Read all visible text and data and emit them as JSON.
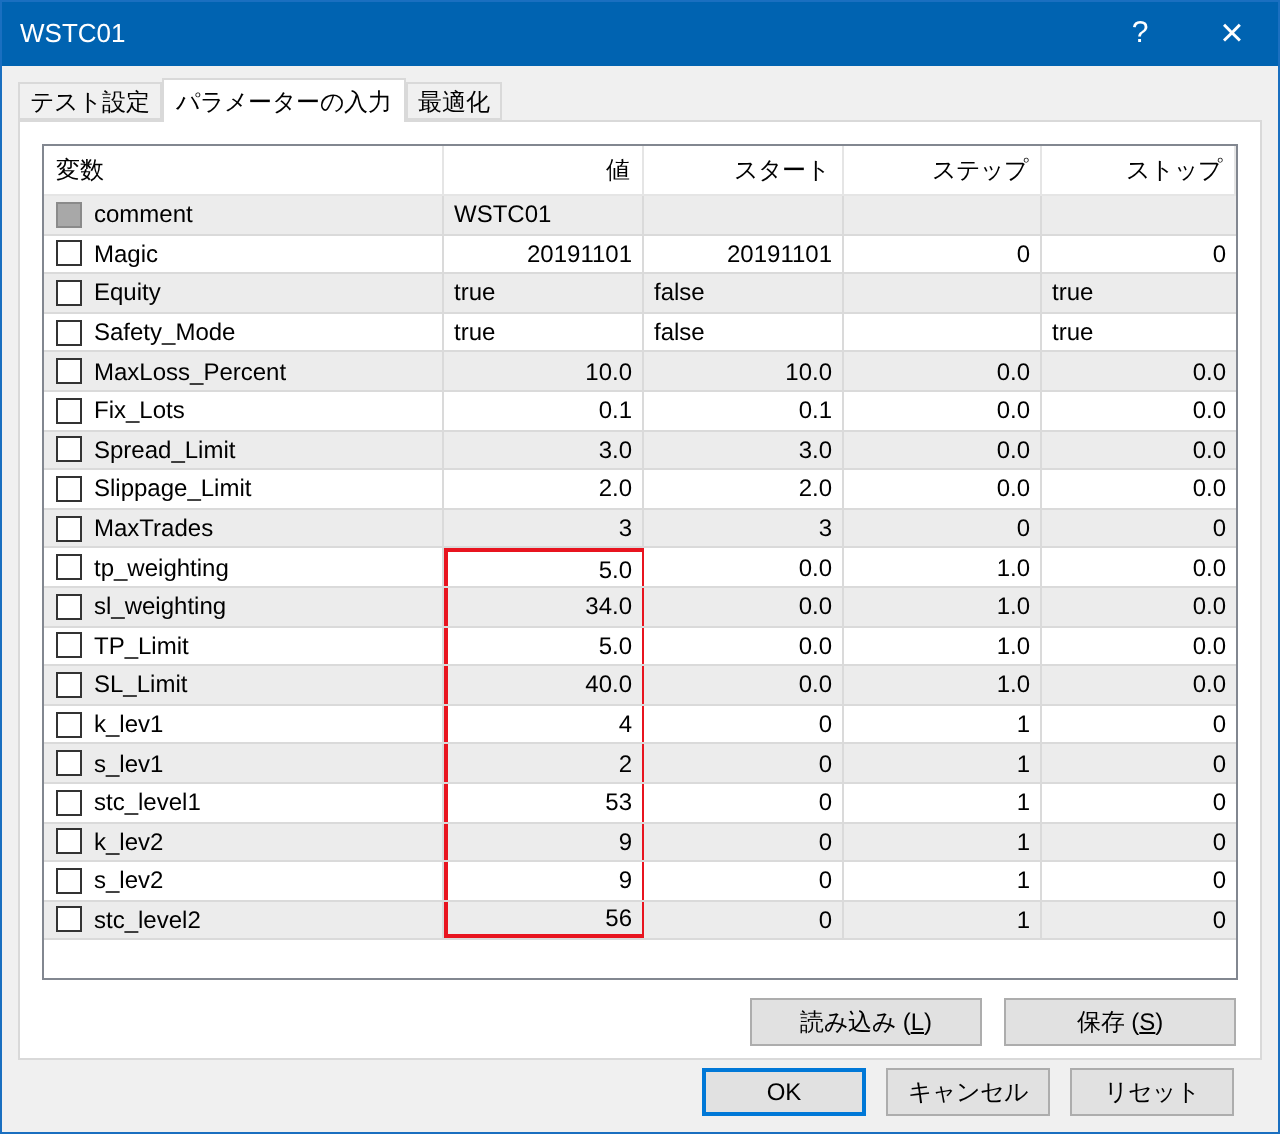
{
  "window": {
    "title": "WSTC01",
    "help": "?",
    "close": "×"
  },
  "tabs": [
    {
      "label": "テスト設定",
      "selected": false
    },
    {
      "label": "パラメーターの入力",
      "selected": true
    },
    {
      "label": "最適化",
      "selected": false
    }
  ],
  "table": {
    "columns": [
      "変数",
      "値",
      "スタート",
      "ステップ",
      "ストップ"
    ],
    "rows": [
      {
        "name": "comment",
        "checked": false,
        "disabled": true,
        "value": "WSTC01",
        "kind": "text",
        "highlighted": false
      },
      {
        "name": "Magic",
        "checked": false,
        "disabled": false,
        "value": "20191101",
        "start": "20191101",
        "step": "0",
        "stop": "0",
        "kind": "number",
        "highlighted": false
      },
      {
        "name": "Equity",
        "checked": false,
        "disabled": false,
        "value": "true",
        "start": "false",
        "stop": "true",
        "kind": "text",
        "highlighted": false
      },
      {
        "name": "Safety_Mode",
        "checked": false,
        "disabled": false,
        "value": "true",
        "start": "false",
        "stop": "true",
        "kind": "text",
        "highlighted": false
      },
      {
        "name": "MaxLoss_Percent",
        "checked": false,
        "disabled": false,
        "value": "10.0",
        "start": "10.0",
        "step": "0.0",
        "stop": "0.0",
        "kind": "number",
        "highlighted": false
      },
      {
        "name": "Fix_Lots",
        "checked": false,
        "disabled": false,
        "value": "0.1",
        "start": "0.1",
        "step": "0.0",
        "stop": "0.0",
        "kind": "number",
        "highlighted": false
      },
      {
        "name": "Spread_Limit",
        "checked": false,
        "disabled": false,
        "value": "3.0",
        "start": "3.0",
        "step": "0.0",
        "stop": "0.0",
        "kind": "number",
        "highlighted": false
      },
      {
        "name": "Slippage_Limit",
        "checked": false,
        "disabled": false,
        "value": "2.0",
        "start": "2.0",
        "step": "0.0",
        "stop": "0.0",
        "kind": "number",
        "highlighted": false
      },
      {
        "name": "MaxTrades",
        "checked": false,
        "disabled": false,
        "value": "3",
        "start": "3",
        "step": "0",
        "stop": "0",
        "kind": "number",
        "highlighted": false
      },
      {
        "name": "tp_weighting",
        "checked": false,
        "disabled": false,
        "value": "5.0",
        "start": "0.0",
        "step": "1.0",
        "stop": "0.0",
        "kind": "number",
        "highlighted": true
      },
      {
        "name": "sl_weighting",
        "checked": false,
        "disabled": false,
        "value": "34.0",
        "start": "0.0",
        "step": "1.0",
        "stop": "0.0",
        "kind": "number",
        "highlighted": true
      },
      {
        "name": "TP_Limit",
        "checked": false,
        "disabled": false,
        "value": "5.0",
        "start": "0.0",
        "step": "1.0",
        "stop": "0.0",
        "kind": "number",
        "highlighted": true
      },
      {
        "name": "SL_Limit",
        "checked": false,
        "disabled": false,
        "value": "40.0",
        "start": "0.0",
        "step": "1.0",
        "stop": "0.0",
        "kind": "number",
        "highlighted": true
      },
      {
        "name": "k_lev1",
        "checked": false,
        "disabled": false,
        "value": "4",
        "start": "0",
        "step": "1",
        "stop": "0",
        "kind": "number",
        "highlighted": true
      },
      {
        "name": "s_lev1",
        "checked": false,
        "disabled": false,
        "value": "2",
        "start": "0",
        "step": "1",
        "stop": "0",
        "kind": "number",
        "highlighted": true
      },
      {
        "name": "stc_level1",
        "checked": false,
        "disabled": false,
        "value": "53",
        "start": "0",
        "step": "1",
        "stop": "0",
        "kind": "number",
        "highlighted": true
      },
      {
        "name": "k_lev2",
        "checked": false,
        "disabled": false,
        "value": "9",
        "start": "0",
        "step": "1",
        "stop": "0",
        "kind": "number",
        "highlighted": true
      },
      {
        "name": "s_lev2",
        "checked": false,
        "disabled": false,
        "value": "9",
        "start": "0",
        "step": "1",
        "stop": "0",
        "kind": "number",
        "highlighted": true
      },
      {
        "name": "stc_level2",
        "checked": false,
        "disabled": false,
        "value": "56",
        "start": "0",
        "step": "1",
        "stop": "0",
        "kind": "number",
        "highlighted": true
      }
    ]
  },
  "panel_buttons": [
    {
      "text_before": "読み込み (",
      "mnemonic": "L",
      "text_after": ")"
    },
    {
      "text_before": "保存 (",
      "mnemonic": "S",
      "text_after": ")"
    }
  ],
  "dialog_buttons": [
    {
      "label": "OK",
      "default": true
    },
    {
      "label": "キャンセル",
      "default": false
    },
    {
      "label": "リセット",
      "default": false
    }
  ]
}
